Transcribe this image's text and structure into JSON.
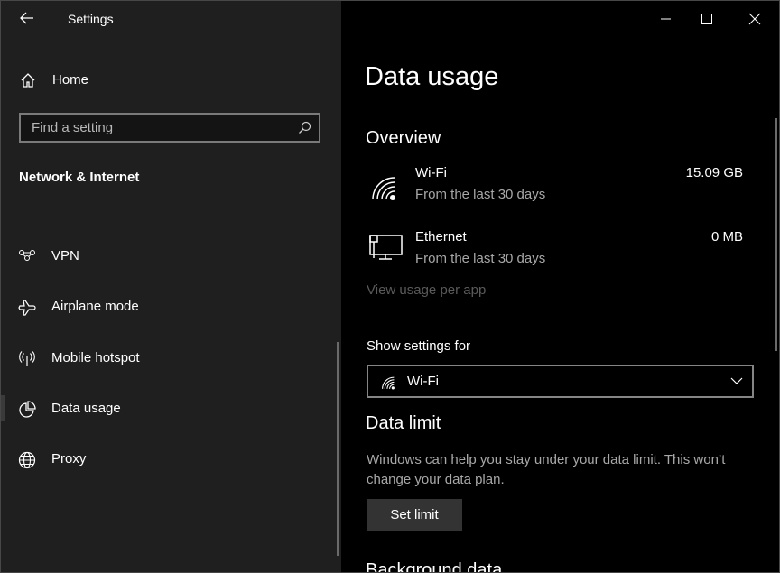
{
  "window": {
    "title": "Settings",
    "controls": {
      "minimize": "minimize",
      "maximize": "maximize",
      "close": "close"
    }
  },
  "sidebar": {
    "home": "Home",
    "search_placeholder": "Find a setting",
    "section": "Network & Internet",
    "items": [
      {
        "label": "VPN",
        "icon": "vpn-icon"
      },
      {
        "label": "Airplane mode",
        "icon": "airplane-icon"
      },
      {
        "label": "Mobile hotspot",
        "icon": "hotspot-icon"
      },
      {
        "label": "Data usage",
        "icon": "pie-chart-icon",
        "selected": true
      },
      {
        "label": "Proxy",
        "icon": "globe-icon"
      }
    ]
  },
  "main": {
    "title": "Data usage",
    "overview": {
      "heading": "Overview",
      "items": [
        {
          "name": "Wi-Fi",
          "sub": "From the last 30 days",
          "value": "15.09 GB"
        },
        {
          "name": "Ethernet",
          "sub": "From the last 30 days",
          "value": "0 MB"
        }
      ],
      "link": "View usage per app"
    },
    "show_settings_for": {
      "label": "Show settings for",
      "selected": "Wi-Fi"
    },
    "data_limit": {
      "heading": "Data limit",
      "description": "Windows can help you stay under your data limit. This won’t change your data plan.",
      "button": "Set limit"
    },
    "background_data": {
      "heading": "Background data"
    }
  },
  "colors": {
    "sidebar_bg": "#1f1f1f",
    "main_bg": "#000000",
    "button_bg": "#333333",
    "link_disabled": "#5a5a5a"
  }
}
